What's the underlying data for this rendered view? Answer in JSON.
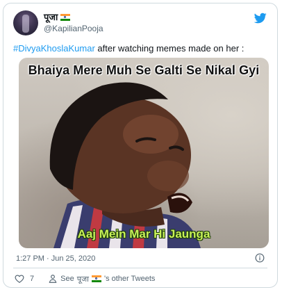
{
  "tweet": {
    "display_name": "पूजा",
    "handle": "@KapilianPooja",
    "hashtag": "#DivyaKhoslaKumar",
    "text_rest": " after watching memes made on her :",
    "timestamp": "1:27 PM · Jun 25, 2020",
    "like_count": "7",
    "see_prefix": "See",
    "see_name": "पूजा",
    "see_suffix": "'s other Tweets"
  },
  "media": {
    "caption_top": "Bhaiya Mere Muh Se Galti Se Nikal Gyi",
    "caption_bottom": "Aaj Mein Mar Hi Jaunga"
  },
  "icons": {
    "brand": "twitter-bird-icon",
    "flag": "india-flag-icon",
    "like": "heart-icon",
    "profile": "person-icon",
    "info": "info-icon"
  },
  "colors": {
    "accent": "#1d9bf0",
    "muted": "#536471",
    "border": "#cfd9de",
    "caption_bottom": "#c8f05a"
  }
}
